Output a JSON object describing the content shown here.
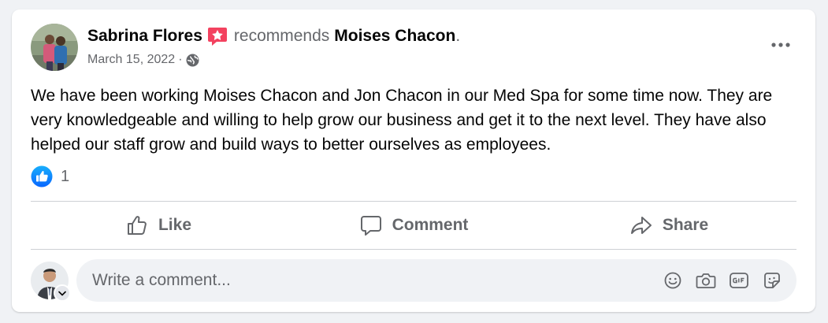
{
  "post": {
    "author_name": "Sabrina Flores",
    "recommends_word": "recommends",
    "target_name": "Moises Chacon",
    "period": ".",
    "date": "March 15, 2022",
    "meta_separator": "·",
    "text": "We have been working Moises Chacon and Jon Chacon in our Med Spa for some time now. They are very knowledgeable and willing to help grow our business and get it to the next level.  They have also helped our staff grow and build ways to better ourselves as employees.",
    "reaction_count": "1"
  },
  "actions": {
    "like_label": "Like",
    "comment_label": "Comment",
    "share_label": "Share"
  },
  "composer": {
    "placeholder": "Write a comment..."
  },
  "icons": {
    "recommend": "recommend-star-icon",
    "privacy": "globe-icon",
    "more": "more-options-icon",
    "reaction": "like-reaction-icon",
    "emoji": "emoji-icon",
    "camera": "camera-icon",
    "gif": "gif-icon",
    "sticker": "sticker-icon"
  },
  "colors": {
    "like_blue": "#1877f2",
    "recommend_red": "#f3425f",
    "secondary_text": "#65676b",
    "background": "#f0f2f5"
  }
}
